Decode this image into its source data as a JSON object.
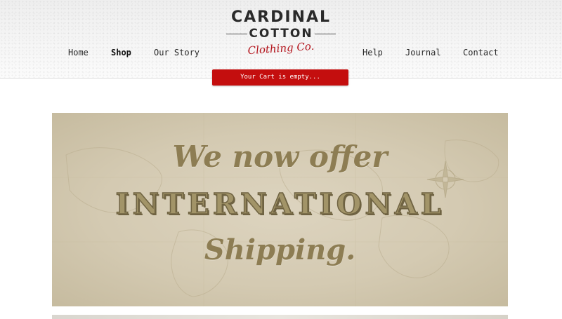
{
  "header": {
    "logo": {
      "line1": "CARDINAL",
      "line2": "COTTON",
      "script": "Clothing Co."
    },
    "nav_left": [
      {
        "label": "Home",
        "active": false
      },
      {
        "label": "Shop",
        "active": true
      },
      {
        "label": "Our Story",
        "active": false
      }
    ],
    "nav_right": [
      {
        "label": "Help",
        "active": false
      },
      {
        "label": "Journal",
        "active": false
      },
      {
        "label": "Contact",
        "active": false
      }
    ]
  },
  "cart": {
    "label": "Your Cart is empty..."
  },
  "banner": {
    "line1": "We now offer",
    "line2": "INTERNATIONAL",
    "line3": "Shipping."
  },
  "colors": {
    "brand_red": "#c40e0e",
    "logo_script_red": "#b3131b",
    "banner_text": "#8d7d53",
    "banner_bg": "#d4cab2"
  }
}
